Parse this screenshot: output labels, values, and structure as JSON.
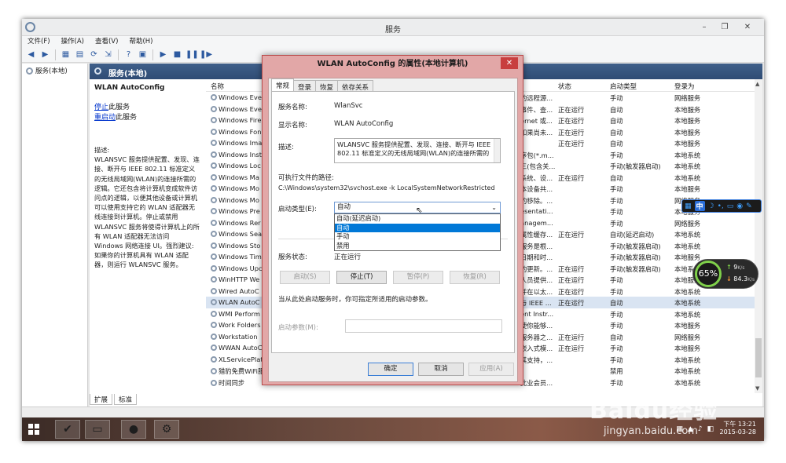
{
  "window": {
    "title": "服务",
    "minimize": "–",
    "restore": "❐",
    "close": "✕"
  },
  "menu": [
    "文件(F)",
    "操作(A)",
    "查看(V)",
    "帮助(H)"
  ],
  "tree": {
    "root": "服务(本地)"
  },
  "header": {
    "title": "服务(本地)"
  },
  "details": {
    "service_title": "WLAN AutoConfig",
    "stop_link": "停止",
    "stop_suffix": "此服务",
    "restart_link": "重启动",
    "restart_suffix": "此服务",
    "description": "描述:\nWLANSVC 服务提供配置、发现、连接、断开与 IEEE 802.11 标准定义的无线局域网(WLAN)的连接所需的逻辑。它还包含将计算机变成软件访问点的逻辑，以便其他设备或计算机可以使用支持它的 WLAN 适配器无线连接到计算机。停止或禁用 WLANSVC 服务将使得计算机上的所有 WLAN 适配器无法访问 Windows 网络连接 UI。强烈建议: 如果你的计算机具有 WLAN 适配器，则运行 WLANSVC 服务。"
  },
  "columns": {
    "name": "名称",
    "status": "状态",
    "startup": "启动类型",
    "logon": "登录为"
  },
  "rows": [
    {
      "name": "Windows Eve",
      "desc": "的远程源...",
      "status": "",
      "startup": "手动",
      "logon": "网络服务"
    },
    {
      "name": "Windows Eve",
      "desc": "事件、查...",
      "status": "正在运行",
      "startup": "自动",
      "logon": "本地服务"
    },
    {
      "name": "Windows Fire",
      "desc": "ernet 或...",
      "status": "正在运行",
      "startup": "自动",
      "logon": "本地服务"
    },
    {
      "name": "Windows Fon",
      "desc": "如果尚未...",
      "status": "正在运行",
      "startup": "自动",
      "logon": "本地服务"
    },
    {
      "name": "Windows Ima",
      "desc": "",
      "status": "正在运行",
      "startup": "自动",
      "logon": "本地服务"
    },
    {
      "name": "Windows Inst",
      "desc": "序包(*.m...",
      "status": "",
      "startup": "手动",
      "logon": "本地系统"
    },
    {
      "name": "Windows Loc",
      "desc": "三(包含关...",
      "status": "",
      "startup": "手动(触发器启动)",
      "logon": "本地系统"
    },
    {
      "name": "Windows Ma",
      "desc": "系统、设...",
      "status": "正在运行",
      "startup": "自动",
      "logon": "本地系统"
    },
    {
      "name": "Windows Mo",
      "desc": "本设备共...",
      "status": "",
      "startup": "手动",
      "logon": "本地服务"
    },
    {
      "name": "Windows Mo",
      "desc": "的移除。...",
      "status": "",
      "startup": "手动",
      "logon": "网络服务"
    },
    {
      "name": "Windows Pre",
      "desc": "esentati...",
      "status": "",
      "startup": "手动",
      "logon": "本地服务"
    },
    {
      "name": "Windows Rer",
      "desc": "anagem...",
      "status": "",
      "startup": "手动",
      "logon": "网络服务"
    },
    {
      "name": "Windows Sea",
      "desc": "属性缓存...",
      "status": "正在运行",
      "startup": "自动(延迟启动)",
      "logon": "本地系统"
    },
    {
      "name": "Windows Sto",
      "desc": "服务是根...",
      "status": "",
      "startup": "手动(触发器启动)",
      "logon": "本地系统"
    },
    {
      "name": "Windows Tim",
      "desc": "日期和时...",
      "status": "",
      "startup": "手动(触发器启动)",
      "logon": "本地服务"
    },
    {
      "name": "Windows Upc",
      "desc": "的更新。...",
      "status": "正在运行",
      "startup": "手动(触发器启动)",
      "logon": "本地系统"
    },
    {
      "name": "WinHTTP We",
      "desc": "人员提供...",
      "status": "正在运行",
      "startup": "手动",
      "logon": "本地服务"
    },
    {
      "name": "Wired AutoC",
      "desc": "并在以太...",
      "status": "正在运行",
      "startup": "手动",
      "logon": "本地系统"
    },
    {
      "name": "WLAN AutoC",
      "desc": "与 IEEE ...",
      "status": "正在运行",
      "startup": "自动",
      "logon": "本地系统",
      "selected": true
    },
    {
      "name": "WMI Perform",
      "desc": "ent Instr...",
      "status": "",
      "startup": "手动",
      "logon": "本地系统"
    },
    {
      "name": "Work Folders",
      "desc": "使你能够...",
      "status": "",
      "startup": "手动",
      "logon": "本地服务"
    },
    {
      "name": "Workstation",
      "desc": "服务器之...",
      "status": "正在运行",
      "startup": "自动",
      "logon": "网络服务"
    },
    {
      "name": "WWAN AutoC",
      "desc": "嵌入式模...",
      "status": "正在运行",
      "startup": "手动",
      "logon": "本地服务"
    },
    {
      "name": "XLServicePlat",
      "desc": "其支持，...",
      "status": "",
      "startup": "手动",
      "logon": "本地系统"
    },
    {
      "name": "猎豹免费WiFi服",
      "desc": "",
      "status": "",
      "startup": "禁用",
      "logon": "本地系统"
    },
    {
      "name": "时间同步",
      "desc": "此业会员...",
      "status": "",
      "startup": "手动",
      "logon": "本地系统"
    }
  ],
  "bottom_tabs": [
    "扩展",
    "标准"
  ],
  "dialog": {
    "title": "WLAN AutoConfig 的属性(本地计算机)",
    "close": "✕",
    "tabs": [
      "常规",
      "登录",
      "恢复",
      "依存关系"
    ],
    "service_name_label": "服务名称:",
    "service_name": "WlanSvc",
    "display_name_label": "显示名称:",
    "display_name": "WLAN AutoConfig",
    "desc_label": "描述:",
    "desc": "WLANSVC 服务提供配置、发现、连接、断开与 IEEE 802.11 标准定义的无线局域网(WLAN)的连接所需的",
    "path_label": "可执行文件的路径:",
    "path": "C:\\Windows\\system32\\svchost.exe -k LocalSystemNetworkRestricted",
    "startup_label": "启动类型(E):",
    "startup_value": "自动",
    "startup_options": [
      "自动(延迟启动)",
      "自动",
      "手动",
      "禁用"
    ],
    "status_label": "服务状态:",
    "status_value": "正在运行",
    "btn_start": "启动(S)",
    "btn_stop": "停止(T)",
    "btn_pause": "暂停(P)",
    "btn_resume": "恢复(R)",
    "hint": "当从此处启动服务时，你可指定所适用的启动参数。",
    "param_label": "启动参数(M):",
    "ok": "确定",
    "cancel": "取消",
    "apply": "应用(A)"
  },
  "tray": {
    "time": "下午 13:21",
    "date": "2015-03-28"
  },
  "ime": {
    "mode": "中"
  },
  "net": {
    "percent": "65%",
    "up": "9",
    "up_unit": "K/s",
    "down": "84.3",
    "down_unit": "K/s"
  },
  "watermark": {
    "logo": "Baidu经验",
    "url": "jingyan.baidu.com"
  }
}
